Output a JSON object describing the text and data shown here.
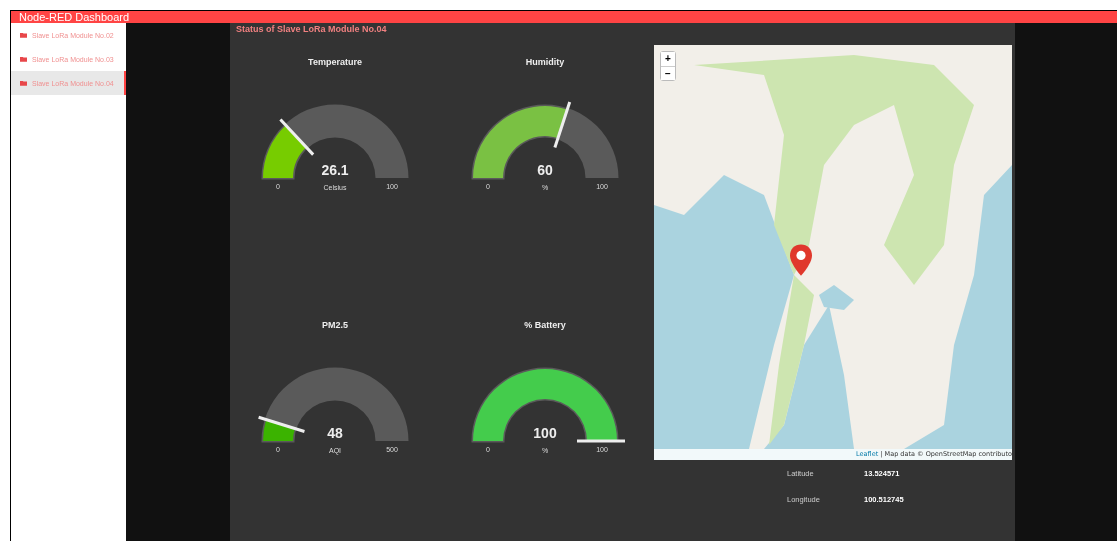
{
  "header": {
    "title": "Node-RED Dashboard"
  },
  "sidebar": {
    "items": [
      {
        "label": "Slave LoRa Module No.02",
        "selected": false
      },
      {
        "label": "Slave LoRa Module No.03",
        "selected": false
      },
      {
        "label": "Slave LoRa Module No.04",
        "selected": true
      }
    ]
  },
  "group": {
    "title": "Status of Slave LoRa Module No.04"
  },
  "gauges": [
    {
      "title": "Temperature",
      "value": "26.1",
      "units": "Celsius",
      "min": "0",
      "max": "100",
      "level": 0.261,
      "color": "#77cc00"
    },
    {
      "title": "Humidity",
      "value": "60",
      "units": "%",
      "min": "0",
      "max": "100",
      "level": 0.6,
      "color": "#7ac143"
    },
    {
      "title": "PM2.5",
      "value": "48",
      "units": "AQI",
      "min": "0",
      "max": "500",
      "level": 0.096,
      "color": "#3bb300"
    },
    {
      "title": "% Battery",
      "value": "100",
      "units": "%",
      "min": "0",
      "max": "100",
      "level": 1,
      "color": "#44cc4c"
    }
  ],
  "map": {
    "zoom_in": "+",
    "zoom_out": "−",
    "attribution_link": "Leaflet",
    "separator": "|",
    "attribution": "Map data © OpenStreetMap contributo"
  },
  "location": [
    {
      "label": "Latitude",
      "value": "13.524571"
    },
    {
      "label": "Longitude",
      "value": "100.512745"
    }
  ]
}
